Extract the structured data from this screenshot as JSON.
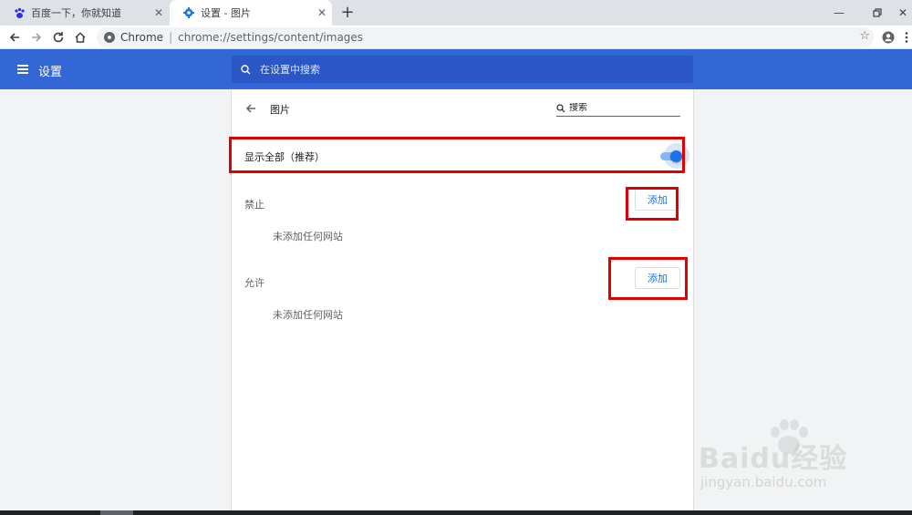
{
  "tabs": [
    {
      "title": "百度一下，你就知道",
      "icon": "baidu-paw-icon"
    },
    {
      "title": "设置 - 图片",
      "icon": "gear-icon"
    }
  ],
  "toolbar": {
    "site_chip": "Chrome",
    "url": "chrome://settings/content/images"
  },
  "header": {
    "title": "设置",
    "search_placeholder": "在设置中搜索"
  },
  "subpage": {
    "title": "图片",
    "search_placeholder": "搜索"
  },
  "show_all": {
    "label": "显示全部（推荐）",
    "enabled": true
  },
  "blocked": {
    "label": "禁止",
    "add_label": "添加",
    "empty_text": "未添加任何网站"
  },
  "allowed": {
    "label": "允许",
    "add_label": "添加",
    "empty_text": "未添加任何网站"
  },
  "watermark": {
    "brand": "Baidu经验",
    "site": "jingyan.baidu.com"
  },
  "colors": {
    "header_blue": "#3367d6",
    "search_blue": "#2a56c6",
    "accent": "#1a73e8",
    "highlight_red": "#e00000"
  }
}
